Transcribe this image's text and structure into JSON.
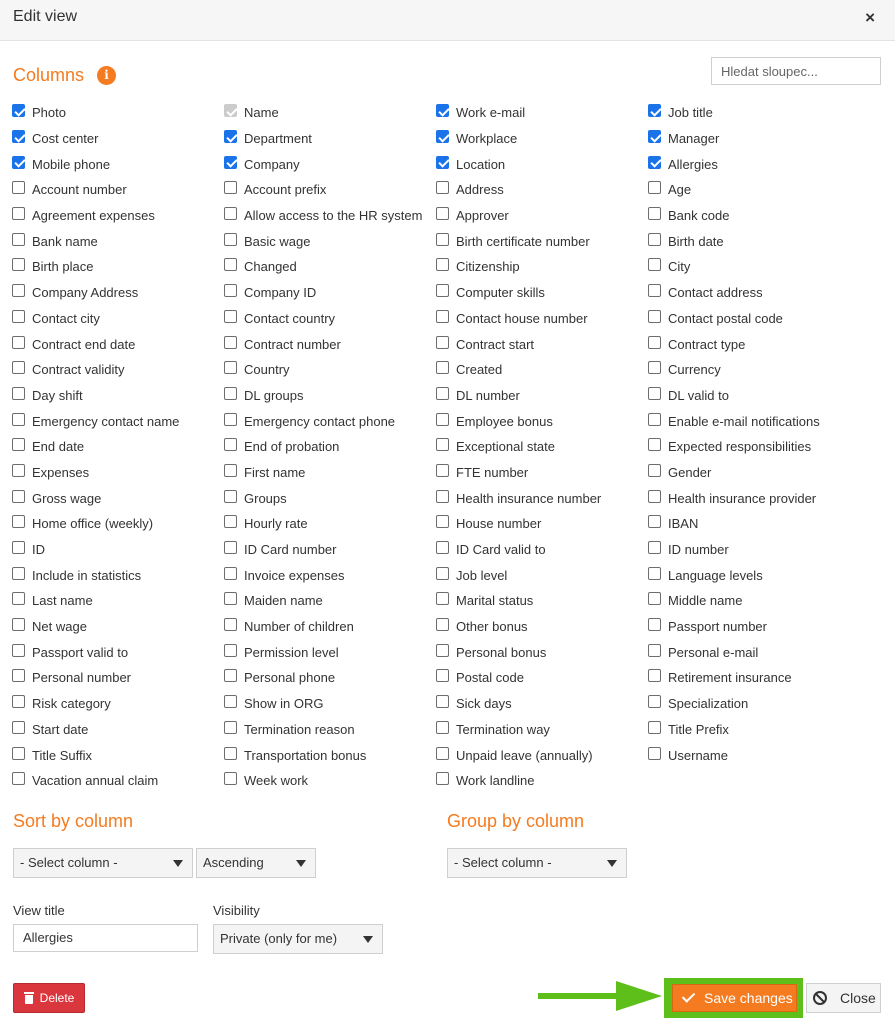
{
  "dialog": {
    "title": "Edit view",
    "close_glyph": "×"
  },
  "columns": {
    "title": "Columns",
    "info_glyph": "i",
    "search_placeholder": "Hledat sloupec...",
    "items": [
      {
        "label": "Photo",
        "checked": true
      },
      {
        "label": "Cost center",
        "checked": true
      },
      {
        "label": "Mobile phone",
        "checked": true
      },
      {
        "label": "Account number",
        "checked": false
      },
      {
        "label": "Agreement expenses",
        "checked": false
      },
      {
        "label": "Bank name",
        "checked": false
      },
      {
        "label": "Birth place",
        "checked": false
      },
      {
        "label": "Company Address",
        "checked": false
      },
      {
        "label": "Contact city",
        "checked": false
      },
      {
        "label": "Contract end date",
        "checked": false
      },
      {
        "label": "Contract validity",
        "checked": false
      },
      {
        "label": "Day shift",
        "checked": false
      },
      {
        "label": "Emergency contact name",
        "checked": false
      },
      {
        "label": "End date",
        "checked": false
      },
      {
        "label": "Expenses",
        "checked": false
      },
      {
        "label": "Gross wage",
        "checked": false
      },
      {
        "label": "Home office (weekly)",
        "checked": false
      },
      {
        "label": "ID",
        "checked": false
      },
      {
        "label": "Include in statistics",
        "checked": false
      },
      {
        "label": "Last name",
        "checked": false
      },
      {
        "label": "Net wage",
        "checked": false
      },
      {
        "label": "Passport valid to",
        "checked": false
      },
      {
        "label": "Personal number",
        "checked": false
      },
      {
        "label": "Risk category",
        "checked": false
      },
      {
        "label": "Start date",
        "checked": false
      },
      {
        "label": "Title Suffix",
        "checked": false
      },
      {
        "label": "Vacation annual claim",
        "checked": false
      },
      {
        "label": "Name",
        "checked": true,
        "disabled": true
      },
      {
        "label": "Department",
        "checked": true
      },
      {
        "label": "Company",
        "checked": true
      },
      {
        "label": "Account prefix",
        "checked": false
      },
      {
        "label": "Allow access to the HR system",
        "checked": false
      },
      {
        "label": "Basic wage",
        "checked": false
      },
      {
        "label": "Changed",
        "checked": false
      },
      {
        "label": "Company ID",
        "checked": false
      },
      {
        "label": "Contact country",
        "checked": false
      },
      {
        "label": "Contract number",
        "checked": false
      },
      {
        "label": "Country",
        "checked": false
      },
      {
        "label": "DL groups",
        "checked": false
      },
      {
        "label": "Emergency contact phone",
        "checked": false
      },
      {
        "label": "End of probation",
        "checked": false
      },
      {
        "label": "First name",
        "checked": false
      },
      {
        "label": "Groups",
        "checked": false
      },
      {
        "label": "Hourly rate",
        "checked": false
      },
      {
        "label": "ID Card number",
        "checked": false
      },
      {
        "label": "Invoice expenses",
        "checked": false
      },
      {
        "label": "Maiden name",
        "checked": false
      },
      {
        "label": "Number of children",
        "checked": false
      },
      {
        "label": "Permission level",
        "checked": false
      },
      {
        "label": "Personal phone",
        "checked": false
      },
      {
        "label": "Show in ORG",
        "checked": false
      },
      {
        "label": "Termination reason",
        "checked": false
      },
      {
        "label": "Transportation bonus",
        "checked": false
      },
      {
        "label": "Week work",
        "checked": false
      },
      {
        "label": "Work e-mail",
        "checked": true
      },
      {
        "label": "Workplace",
        "checked": true
      },
      {
        "label": "Location",
        "checked": true
      },
      {
        "label": "Address",
        "checked": false
      },
      {
        "label": "Approver",
        "checked": false
      },
      {
        "label": "Birth certificate number",
        "checked": false
      },
      {
        "label": "Citizenship",
        "checked": false
      },
      {
        "label": "Computer skills",
        "checked": false
      },
      {
        "label": "Contact house number",
        "checked": false
      },
      {
        "label": "Contract start",
        "checked": false
      },
      {
        "label": "Created",
        "checked": false
      },
      {
        "label": "DL number",
        "checked": false
      },
      {
        "label": "Employee bonus",
        "checked": false
      },
      {
        "label": "Exceptional state",
        "checked": false
      },
      {
        "label": "FTE number",
        "checked": false
      },
      {
        "label": "Health insurance number",
        "checked": false
      },
      {
        "label": "House number",
        "checked": false
      },
      {
        "label": "ID Card valid to",
        "checked": false
      },
      {
        "label": "Job level",
        "checked": false
      },
      {
        "label": "Marital status",
        "checked": false
      },
      {
        "label": "Other bonus",
        "checked": false
      },
      {
        "label": "Personal bonus",
        "checked": false
      },
      {
        "label": "Postal code",
        "checked": false
      },
      {
        "label": "Sick days",
        "checked": false
      },
      {
        "label": "Termination way",
        "checked": false
      },
      {
        "label": "Unpaid leave (annually)",
        "checked": false
      },
      {
        "label": "Work landline",
        "checked": false
      },
      {
        "label": "Job title",
        "checked": true
      },
      {
        "label": "Manager",
        "checked": true
      },
      {
        "label": "Allergies",
        "checked": true
      },
      {
        "label": "Age",
        "checked": false
      },
      {
        "label": "Bank code",
        "checked": false
      },
      {
        "label": "Birth date",
        "checked": false
      },
      {
        "label": "City",
        "checked": false
      },
      {
        "label": "Contact address",
        "checked": false
      },
      {
        "label": "Contact postal code",
        "checked": false
      },
      {
        "label": "Contract type",
        "checked": false
      },
      {
        "label": "Currency",
        "checked": false
      },
      {
        "label": "DL valid to",
        "checked": false
      },
      {
        "label": "Enable e-mail notifications",
        "checked": false
      },
      {
        "label": "Expected responsibilities",
        "checked": false
      },
      {
        "label": "Gender",
        "checked": false
      },
      {
        "label": "Health insurance provider",
        "checked": false
      },
      {
        "label": "IBAN",
        "checked": false
      },
      {
        "label": "ID number",
        "checked": false
      },
      {
        "label": "Language levels",
        "checked": false
      },
      {
        "label": "Middle name",
        "checked": false
      },
      {
        "label": "Passport number",
        "checked": false
      },
      {
        "label": "Personal e-mail",
        "checked": false
      },
      {
        "label": "Retirement insurance",
        "checked": false
      },
      {
        "label": "Specialization",
        "checked": false
      },
      {
        "label": "Title Prefix",
        "checked": false
      },
      {
        "label": "Username",
        "checked": false
      }
    ]
  },
  "sort": {
    "title": "Sort by column",
    "column_value": "- Select column -",
    "order_value": "Ascending"
  },
  "group": {
    "title": "Group by column",
    "column_value": "- Select column -"
  },
  "view": {
    "title_label": "View title",
    "title_value": "Allergies",
    "visibility_label": "Visibility",
    "visibility_value": "Private (only for me)"
  },
  "buttons": {
    "delete": "Delete",
    "save": "Save changes",
    "close": "Close"
  },
  "colors": {
    "accent": "#f47b20",
    "checkbox": "#1a73e8",
    "delete": "#d9363e",
    "highlight": "#5fbf1a"
  }
}
